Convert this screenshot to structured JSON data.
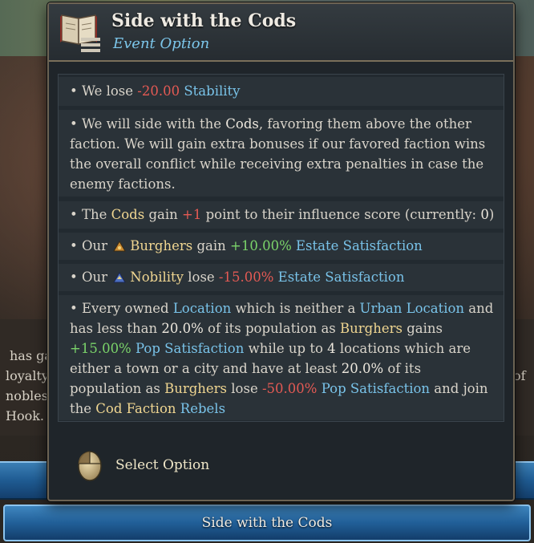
{
  "background": {
    "description_lines": [
      "has ga",
      "loyalty",
      "nobles",
      "Hook."
    ],
    "right_fragment": "of",
    "button_label": "Side with the Cods"
  },
  "tooltip": {
    "title": "Side with the Cods",
    "subtitle": "Event Option",
    "select_label": "Select Option"
  },
  "effects": {
    "e1": {
      "bullet": "• We lose ",
      "value": "-20.00",
      "metric": "Stability"
    },
    "e2": {
      "text": [
        "• We will side with the ",
        "Cods",
        ", favoring them above the other faction. We will gain extra bonuses if our favored faction wins the overall conflict while receiving extra penalties in case the enemy factions."
      ]
    },
    "e3": {
      "t1": "• The ",
      "faction": "Cods",
      "t2": " gain ",
      "value": "+1",
      "t3": " point to their influence score (currently: ",
      "current": "0",
      "t4": ")"
    },
    "e4": {
      "t1": "• Our ",
      "estate": "Burghers",
      "t2": " gain ",
      "value": "+10.00%",
      "metric": "Estate Satisfaction"
    },
    "e5": {
      "t1": "• Our ",
      "estate": "Nobility",
      "t2": " lose ",
      "value": "-15.00%",
      "metric": "Estate Satisfaction"
    },
    "e6": {
      "t1": "• Every owned ",
      "location": "Location",
      "t2": " which is neither a ",
      "urban": "Urban Location",
      "t3": " and has less than ",
      "pct1": "20.0%",
      "t4": " of its population as ",
      "burghers1": "Burghers",
      "t5": " gains ",
      "gain": "+15.00%",
      "pop1": "Pop Satisfaction",
      "t6": " while up to ",
      "count": "4",
      "t7": " locations which are either a town or a city and have at least ",
      "pct2": "20.0%",
      "t8": " of its population as ",
      "burghers2": "Burghers",
      "t9": " lose ",
      "loss": "-50.00%",
      "pop2": "Pop Satisfaction",
      "t10": " and join the ",
      "faction": "Cod Faction",
      "rebels": "Rebels"
    }
  },
  "colors": {
    "negative": "#e45a54",
    "positive": "#7bd46a",
    "link": "#79c3e9",
    "highlight": "#f0d691"
  },
  "icons": [
    "book-icon",
    "burghers-icon",
    "nobility-icon",
    "mouse-icon"
  ]
}
